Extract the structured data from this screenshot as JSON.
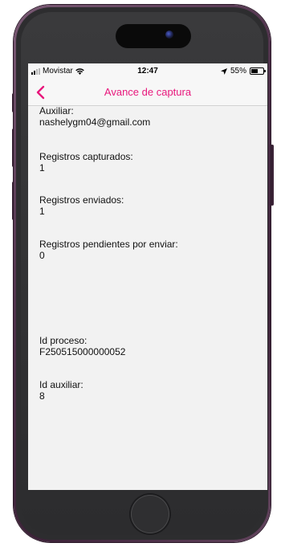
{
  "status_bar": {
    "carrier": "Movistar",
    "time": "12:47",
    "battery": "55%",
    "battery_level": 0.55,
    "icons": [
      "signal-icon",
      "wifi-icon",
      "location-arrow-icon",
      "battery-icon"
    ]
  },
  "nav": {
    "back_icon": "chevron-left-icon",
    "title": "Avance de captura",
    "accent_color": "#e8177c"
  },
  "fields": {
    "auxiliar": {
      "label": "Auxiliar:",
      "value": "nashelygm04@gmail.com"
    },
    "capturados": {
      "label": "Registros capturados:",
      "value": "1"
    },
    "enviados": {
      "label": "Registros enviados:",
      "value": "1"
    },
    "pendientes": {
      "label": "Registros pendientes por enviar:",
      "value": "0"
    },
    "id_proceso": {
      "label": "Id proceso:",
      "value": "F250515000000052"
    },
    "id_auxiliar": {
      "label": "Id auxiliar:",
      "value": "8"
    }
  }
}
